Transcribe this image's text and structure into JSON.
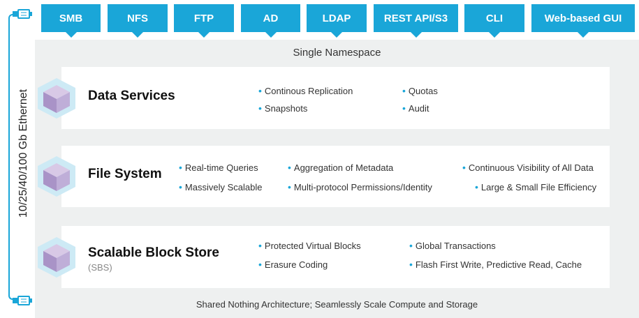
{
  "protocols": [
    "SMB",
    "NFS",
    "FTP",
    "AD",
    "LDAP",
    "REST API/S3",
    "CLI",
    "Web-based GUI"
  ],
  "namespace_label": "Single Namespace",
  "ethernet_label": "10/25/40/100 Gb Ethernet",
  "footer_label": "Shared Nothing Architecture; Seamlessly Scale Compute and Storage",
  "colors": {
    "accent": "#1aa6d8",
    "panel": "#eef0f0",
    "cube": "#b9a6cf"
  },
  "layers": [
    {
      "title": "Data Services",
      "subtitle": "",
      "bullets": [
        "Continous Replication",
        "Snapshots",
        "Quotas",
        "Audit"
      ]
    },
    {
      "title": "File System",
      "subtitle": "",
      "bullets": [
        "Real-time Queries",
        "Massively Scalable",
        "Aggregation of Metadata",
        "Multi-protocol Permissions/Identity",
        "Continuous Visibility of All Data",
        "Large & Small File Efficiency"
      ]
    },
    {
      "title": "Scalable Block Store",
      "subtitle": "(SBS)",
      "bullets": [
        "Protected Virtual Blocks",
        "Erasure Coding",
        "Global Transactions",
        "Flash First Write, Predictive Read, Cache"
      ]
    }
  ]
}
